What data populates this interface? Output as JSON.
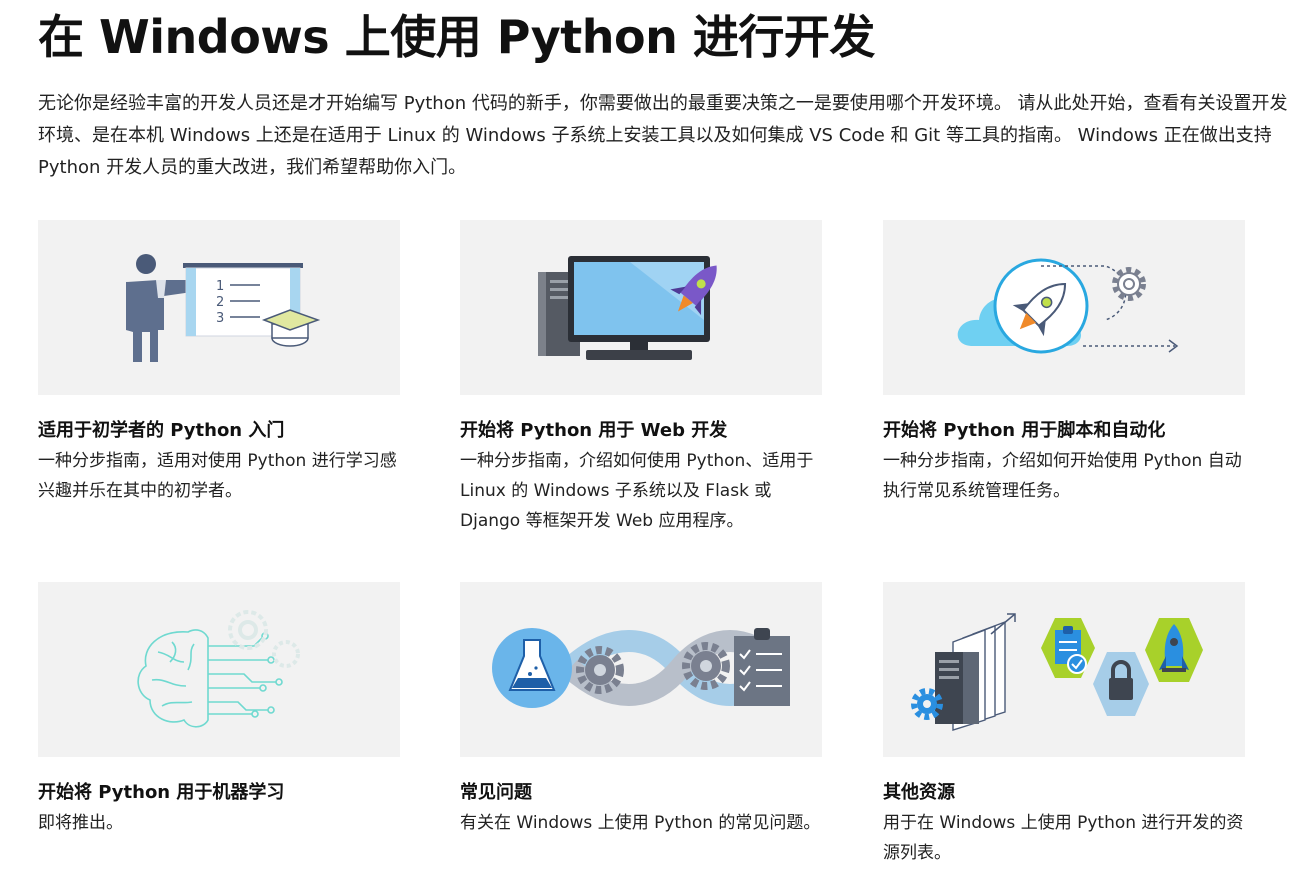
{
  "page": {
    "title": "在 Windows 上使用 Python 进行开发",
    "intro": "无论你是经验丰富的开发人员还是才开始编写 Python 代码的新手，你需要做出的最重要决策之一是要使用哪个开发环境。 请从此处开始，查看有关设置开发环境、是在本机 Windows 上还是在适用于 Linux 的 Windows 子系统上安装工具以及如何集成 VS Code 和 Git 等工具的指南。 Windows 正在做出支持 Python 开发人员的重大改进，我们希望帮助你入门。"
  },
  "cards": [
    {
      "title": "适用于初学者的 Python 入门",
      "description": "一种分步指南，适用对使用 Python 进行学习感兴趣并乐在其中的初学者。",
      "icon": "teacher-whiteboard-icon",
      "board_items": [
        "1",
        "2",
        "3"
      ]
    },
    {
      "title": "开始将 Python 用于 Web 开发",
      "description": "一种分步指南，介绍如何使用 Python、适用于 Linux 的 Windows 子系统以及 Flask 或 Django 等框架开发 Web 应用程序。",
      "icon": "desktop-rocket-icon"
    },
    {
      "title": "开始将 Python 用于脚本和自动化",
      "description": "一种分步指南，介绍如何开始使用 Python 自动执行常见系统管理任务。",
      "icon": "cloud-rocket-gear-icon"
    },
    {
      "title": "开始将 Python 用于机器学习",
      "description": "即将推出。",
      "icon": "circuit-brain-icon"
    },
    {
      "title": "常见问题",
      "description": "有关在 Windows 上使用 Python 的常见问题。",
      "icon": "flask-gears-checklist-icon"
    },
    {
      "title": "其他资源",
      "description": "用于在 Windows 上使用 Python 进行开发的资源列表。",
      "icon": "server-resources-icon"
    }
  ]
}
